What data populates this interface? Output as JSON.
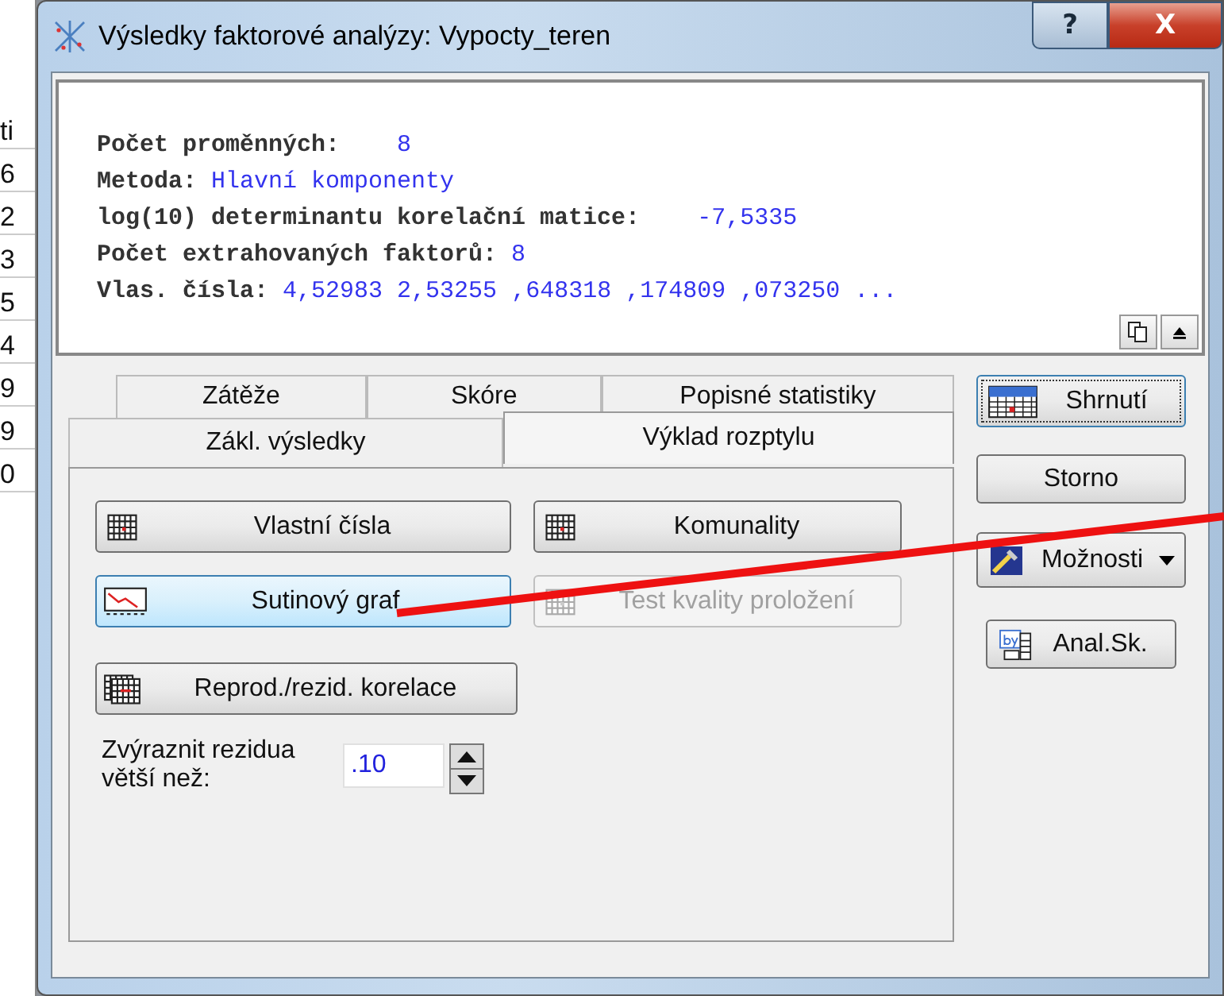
{
  "background_sheet": {
    "cells": [
      "ti",
      "6",
      "2",
      "3",
      "5",
      "4",
      "9",
      "9",
      "0"
    ]
  },
  "window": {
    "title": "Výsledky faktorové analýzy: Vypocty_teren",
    "title_buttons": [
      {
        "kind": "help",
        "label": "?"
      },
      {
        "kind": "close",
        "label": "X"
      }
    ]
  },
  "output": {
    "lines": [
      {
        "label": "Počet proměnných:",
        "values": [
          "8"
        ],
        "kind": "wide"
      },
      {
        "label": "Metoda:",
        "values": [
          "Hlavní komponenty"
        ],
        "kind": "plain"
      },
      {
        "label": "log(10) determinantu korelační matice:",
        "values": [
          "-7,5335"
        ],
        "kind": "wide"
      },
      {
        "label": "Počet extrahovaných faktorů:",
        "values": [
          "8"
        ],
        "kind": "plain"
      },
      {
        "label": "Vlas. čísla:",
        "values": [
          "4,52983",
          "2,53255",
          ",648318",
          ",174809",
          ",073250",
          "..."
        ],
        "kind": "plain"
      }
    ]
  },
  "tabs": {
    "back_row": [
      {
        "label": "Zátěže",
        "selected": false
      },
      {
        "label": "Skóre",
        "selected": false
      },
      {
        "label": "Popisné statistiky",
        "selected": false
      }
    ],
    "front_row": [
      {
        "label": "Zákl. výsledky",
        "selected": false
      },
      {
        "label": "Výklad rozptylu",
        "selected": true
      }
    ]
  },
  "panel": {
    "buttons": [
      {
        "label": "Vlastní čísla",
        "kind": "table",
        "highlighted": false,
        "disabled": false
      },
      {
        "label": "Komunality",
        "kind": "table",
        "highlighted": false,
        "disabled": false
      },
      {
        "label": "Sutinový graf",
        "kind": "chart",
        "highlighted": true,
        "disabled": false
      },
      {
        "label": "Test kvality proložení",
        "kind": "table",
        "highlighted": false,
        "disabled": true
      },
      {
        "label": "Reprod./rezid. korelace",
        "kind": "tables",
        "highlighted": false,
        "disabled": false
      }
    ],
    "residual_field": {
      "label": "Zvýraznit rezidua větší než:",
      "value": ".10"
    }
  },
  "side_buttons": [
    {
      "label": "Shrnutí",
      "kind": "summary",
      "focused": true
    },
    {
      "label": "Storno",
      "kind": "plain",
      "focused": false
    },
    {
      "label": "Možnosti",
      "kind": "options",
      "focused": false
    },
    {
      "label": "Anal.Sk.",
      "kind": "byscan",
      "focused": false
    }
  ],
  "annotation": {
    "kind": "red-line"
  }
}
